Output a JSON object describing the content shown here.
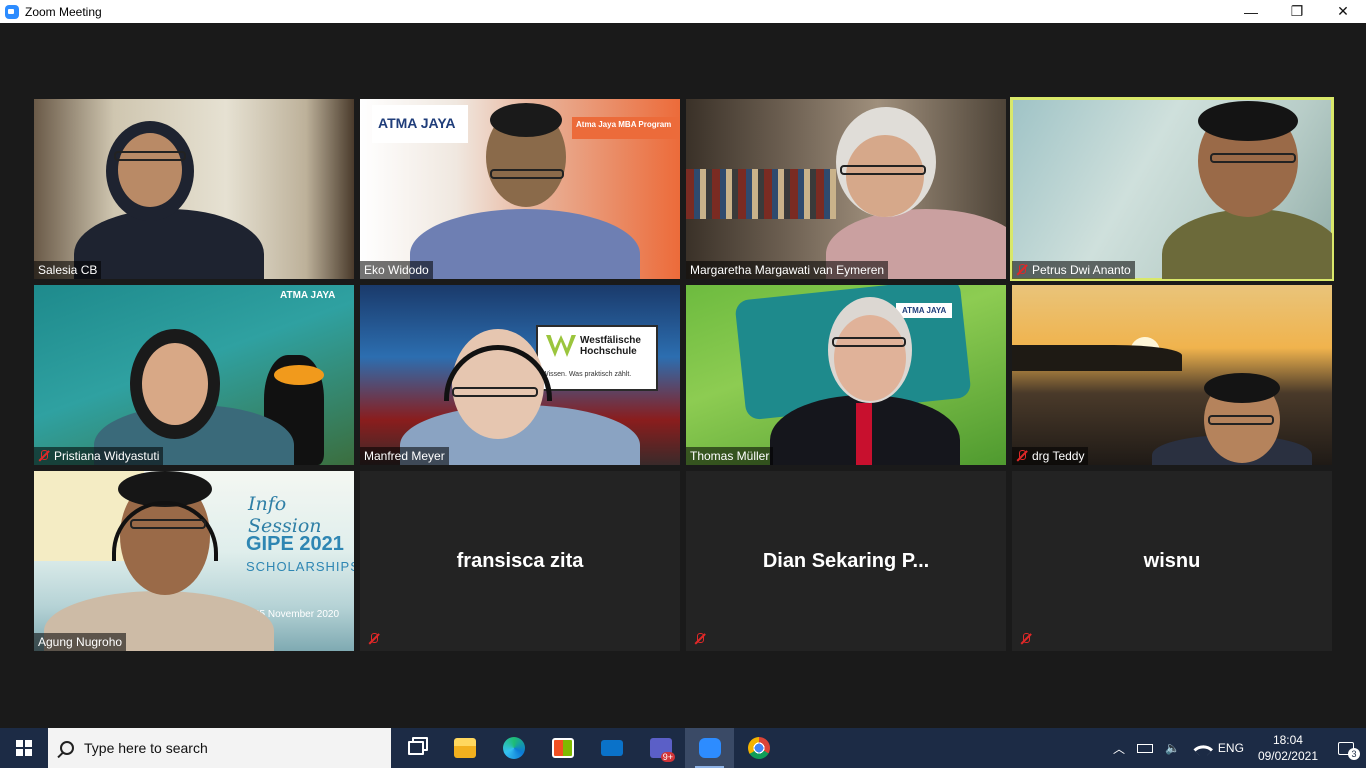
{
  "window": {
    "title": "Zoom Meeting",
    "controls": {
      "minimize": "—",
      "restore": "❐",
      "close": "✕"
    }
  },
  "participants": [
    {
      "name": "Salesia CB",
      "muted": false,
      "video": true
    },
    {
      "name": "Eko Widodo",
      "muted": false,
      "video": true,
      "background_logo": "ATMA JAYA",
      "background_banner": "Atma Jaya MBA Program"
    },
    {
      "name": "Margaretha Margawati van Eymeren",
      "muted": false,
      "video": true
    },
    {
      "name": "Petrus Dwi Ananto",
      "muted": true,
      "video": true,
      "active_speaker": true
    },
    {
      "name": "Pristiana Widyastuti",
      "muted": true,
      "video": true,
      "background_logo": "ATMA JAYA"
    },
    {
      "name": "Manfred Meyer",
      "muted": false,
      "video": true,
      "background_logo": "Westfälische Hochschule",
      "background_tagline": "Wissen. Was praktisch zählt."
    },
    {
      "name": "Thomas Müller",
      "muted": false,
      "video": true,
      "background_logo": "ATMA JAYA"
    },
    {
      "name": "drg Teddy",
      "muted": true,
      "video": true
    },
    {
      "name": "Agung Nugroho",
      "muted": false,
      "video": true,
      "background_heading": "Info Session",
      "background_title": "GIPE 2021",
      "background_subtitle": "SCHOLARSHIPS",
      "background_date": "25 November 2020"
    },
    {
      "name": "fransisca zita",
      "muted": true,
      "video": false
    },
    {
      "name": "Dian Sekaring P...",
      "muted": true,
      "video": false
    },
    {
      "name": "wisnu",
      "muted": true,
      "video": false
    }
  ],
  "taskbar": {
    "search_placeholder": "Type here to search",
    "apps": [
      {
        "icon": "task-view-icon"
      },
      {
        "icon": "file-explorer-icon"
      },
      {
        "icon": "edge-icon"
      },
      {
        "icon": "store-icon"
      },
      {
        "icon": "mail-icon"
      },
      {
        "icon": "teams-icon",
        "badge": "9+"
      },
      {
        "icon": "zoom-icon",
        "active": true
      },
      {
        "icon": "chrome-icon"
      }
    ],
    "tray": {
      "language": "ENG",
      "time": "18:04",
      "date": "09/02/2021",
      "notifications": "3"
    }
  },
  "colors": {
    "active_speaker_border": "#d9e86a",
    "mute": "#e02828",
    "taskbar": "#1c2b45"
  }
}
